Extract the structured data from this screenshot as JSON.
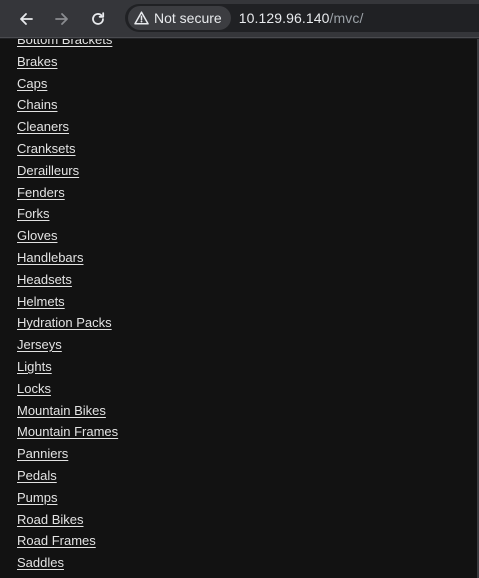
{
  "browser": {
    "security_label": "Not secure",
    "url_host": "10.129.96.140",
    "url_path": "/mvc/"
  },
  "categories": [
    "Bottom Brackets",
    "Brakes",
    "Caps",
    "Chains",
    "Cleaners",
    "Cranksets",
    "Derailleurs",
    "Fenders",
    "Forks",
    "Gloves",
    "Handlebars",
    "Headsets",
    "Helmets",
    "Hydration Packs",
    "Jerseys",
    "Lights",
    "Locks",
    "Mountain Bikes",
    "Mountain Frames",
    "Panniers",
    "Pedals",
    "Pumps",
    "Road Bikes",
    "Road Frames",
    "Saddles"
  ]
}
